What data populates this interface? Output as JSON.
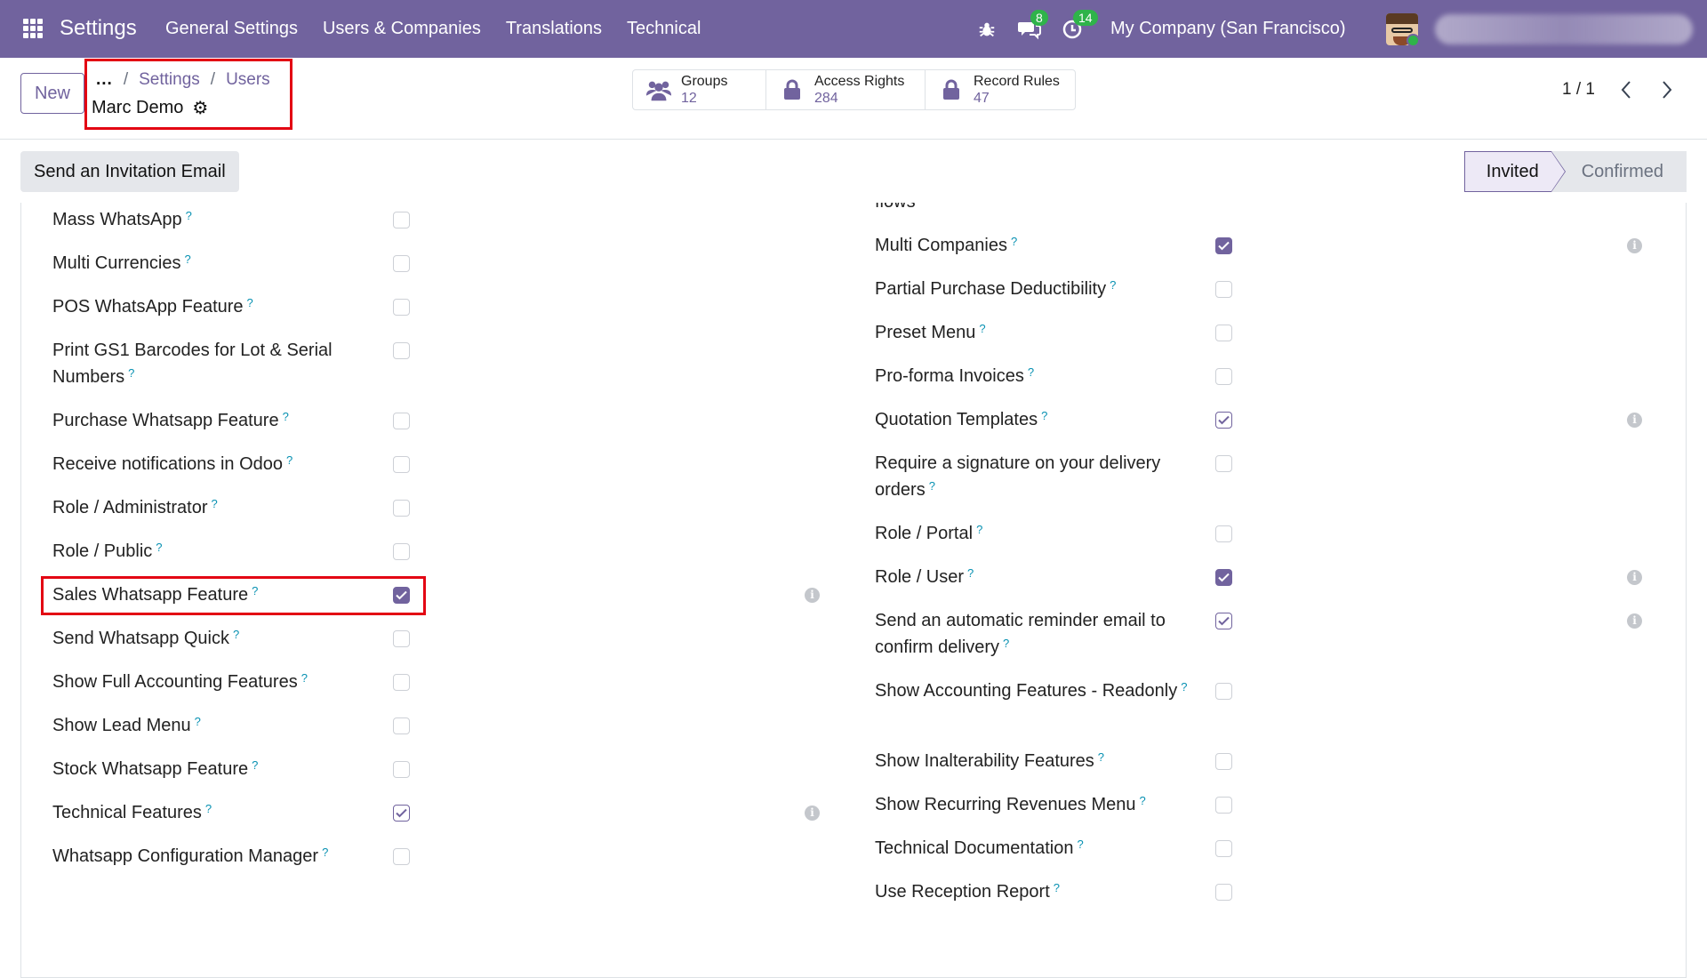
{
  "navbar": {
    "brand": "Settings",
    "menu": [
      "General Settings",
      "Users & Companies",
      "Translations",
      "Technical"
    ],
    "messages_badge": "8",
    "activities_badge": "14",
    "company": "My Company (San Francisco)",
    "accent": "#71639e"
  },
  "control": {
    "new_label": "New",
    "breadcrumb_dots": "...",
    "breadcrumb": [
      "Settings",
      "Users"
    ],
    "record_title": "Marc Demo",
    "smart_buttons": [
      {
        "label": "Groups",
        "value": "12",
        "icon": "users-icon"
      },
      {
        "label": "Access Rights",
        "value": "284",
        "icon": "lock-icon"
      },
      {
        "label": "Record Rules",
        "value": "47",
        "icon": "lock-icon"
      }
    ],
    "pager": "1 / 1"
  },
  "status": {
    "invite_label": "Send an Invitation Email",
    "stages": [
      "Invited",
      "Confirmed"
    ],
    "active_stage": "Invited"
  },
  "left_fields": [
    {
      "label": "Mass WhatsApp",
      "state": "unchecked"
    },
    {
      "label": "Multi Currencies",
      "state": "unchecked"
    },
    {
      "label": "POS WhatsApp Feature",
      "state": "unchecked"
    },
    {
      "label": "Print GS1 Barcodes for Lot & Serial Numbers",
      "state": "unchecked"
    },
    {
      "label": "Purchase Whatsapp Feature",
      "state": "unchecked"
    },
    {
      "label": "Receive notifications in Odoo",
      "state": "unchecked"
    },
    {
      "label": "Role / Administrator",
      "state": "unchecked"
    },
    {
      "label": "Role / Public",
      "state": "unchecked"
    },
    {
      "label": "Sales Whatsapp Feature",
      "state": "checked",
      "info": true
    },
    {
      "label": "Send Whatsapp Quick",
      "state": "unchecked"
    },
    {
      "label": "Show Full Accounting Features",
      "state": "unchecked"
    },
    {
      "label": "Show Lead Menu",
      "state": "unchecked"
    },
    {
      "label": "Stock Whatsapp Feature",
      "state": "unchecked"
    },
    {
      "label": "Technical Features",
      "state": "checked-outline",
      "info": true
    },
    {
      "label": "Whatsapp Configuration Manager",
      "state": "unchecked"
    }
  ],
  "right_cut_label": "flows",
  "right_fields": [
    {
      "label": "Multi Companies",
      "state": "checked",
      "info": true
    },
    {
      "label": "Partial Purchase Deductibility",
      "state": "unchecked"
    },
    {
      "label": "Preset Menu",
      "state": "unchecked"
    },
    {
      "label": "Pro-forma Invoices",
      "state": "unchecked"
    },
    {
      "label": "Quotation Templates",
      "state": "checked-outline",
      "info": true
    },
    {
      "label": "Require a signature on your delivery orders",
      "state": "unchecked"
    },
    {
      "label": "Role / Portal",
      "state": "unchecked"
    },
    {
      "label": "Role / User",
      "state": "checked",
      "info": true
    },
    {
      "label": "Send an automatic reminder email to confirm delivery",
      "state": "checked-outline",
      "info": true
    },
    {
      "label": "Show Accounting Features - Readonly",
      "state": "unchecked"
    },
    {
      "label": "Show Inalterability Features",
      "state": "unchecked"
    },
    {
      "label": "Show Recurring Revenues Menu",
      "state": "unchecked"
    },
    {
      "label": "Technical Documentation",
      "state": "unchecked"
    },
    {
      "label": "Use Reception Report",
      "state": "unchecked"
    }
  ]
}
